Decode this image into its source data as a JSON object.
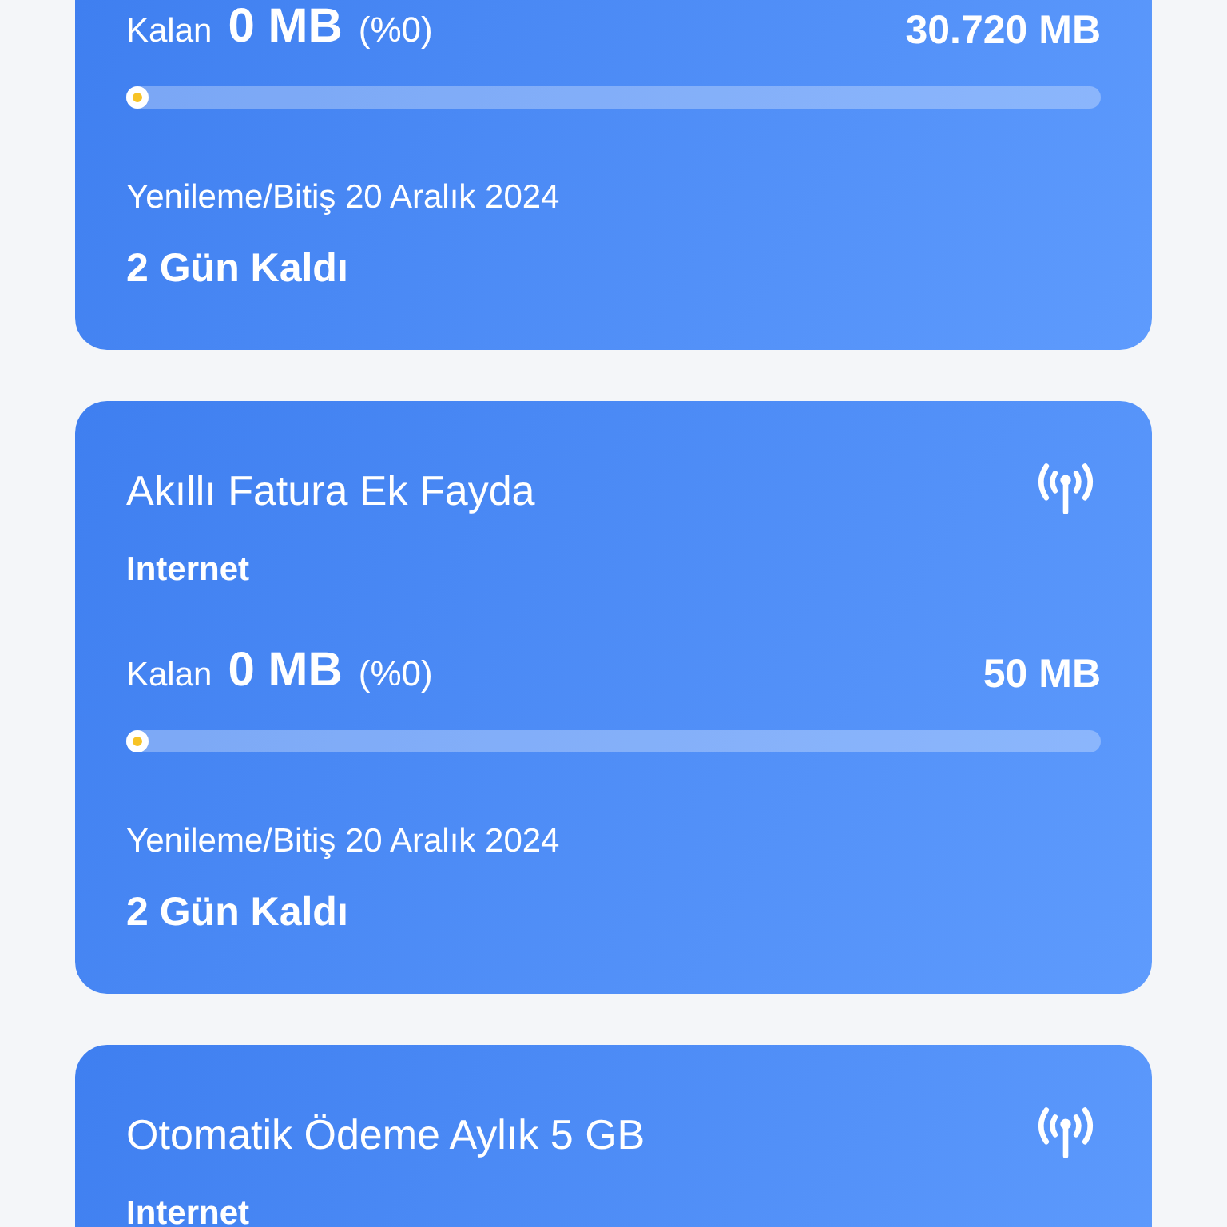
{
  "cards": [
    {
      "usage": {
        "label": "Kalan",
        "remaining": "0 MB",
        "percent": "(%0)",
        "total": "30.720 MB",
        "level": 0
      },
      "renewal": "Yenileme/Bitiş 20 Aralık 2024",
      "days_left": "2 Gün Kaldı"
    },
    {
      "title": "Akıllı Fatura Ek Fayda",
      "type": "Internet",
      "usage": {
        "label": "Kalan",
        "remaining": "0 MB",
        "percent": "(%0)",
        "total": "50 MB",
        "level": 0
      },
      "renewal": "Yenileme/Bitiş 20 Aralık 2024",
      "days_left": "2 Gün Kaldı"
    },
    {
      "title": "Otomatik Ödeme Aylık 5 GB",
      "type": "Internet"
    }
  ]
}
